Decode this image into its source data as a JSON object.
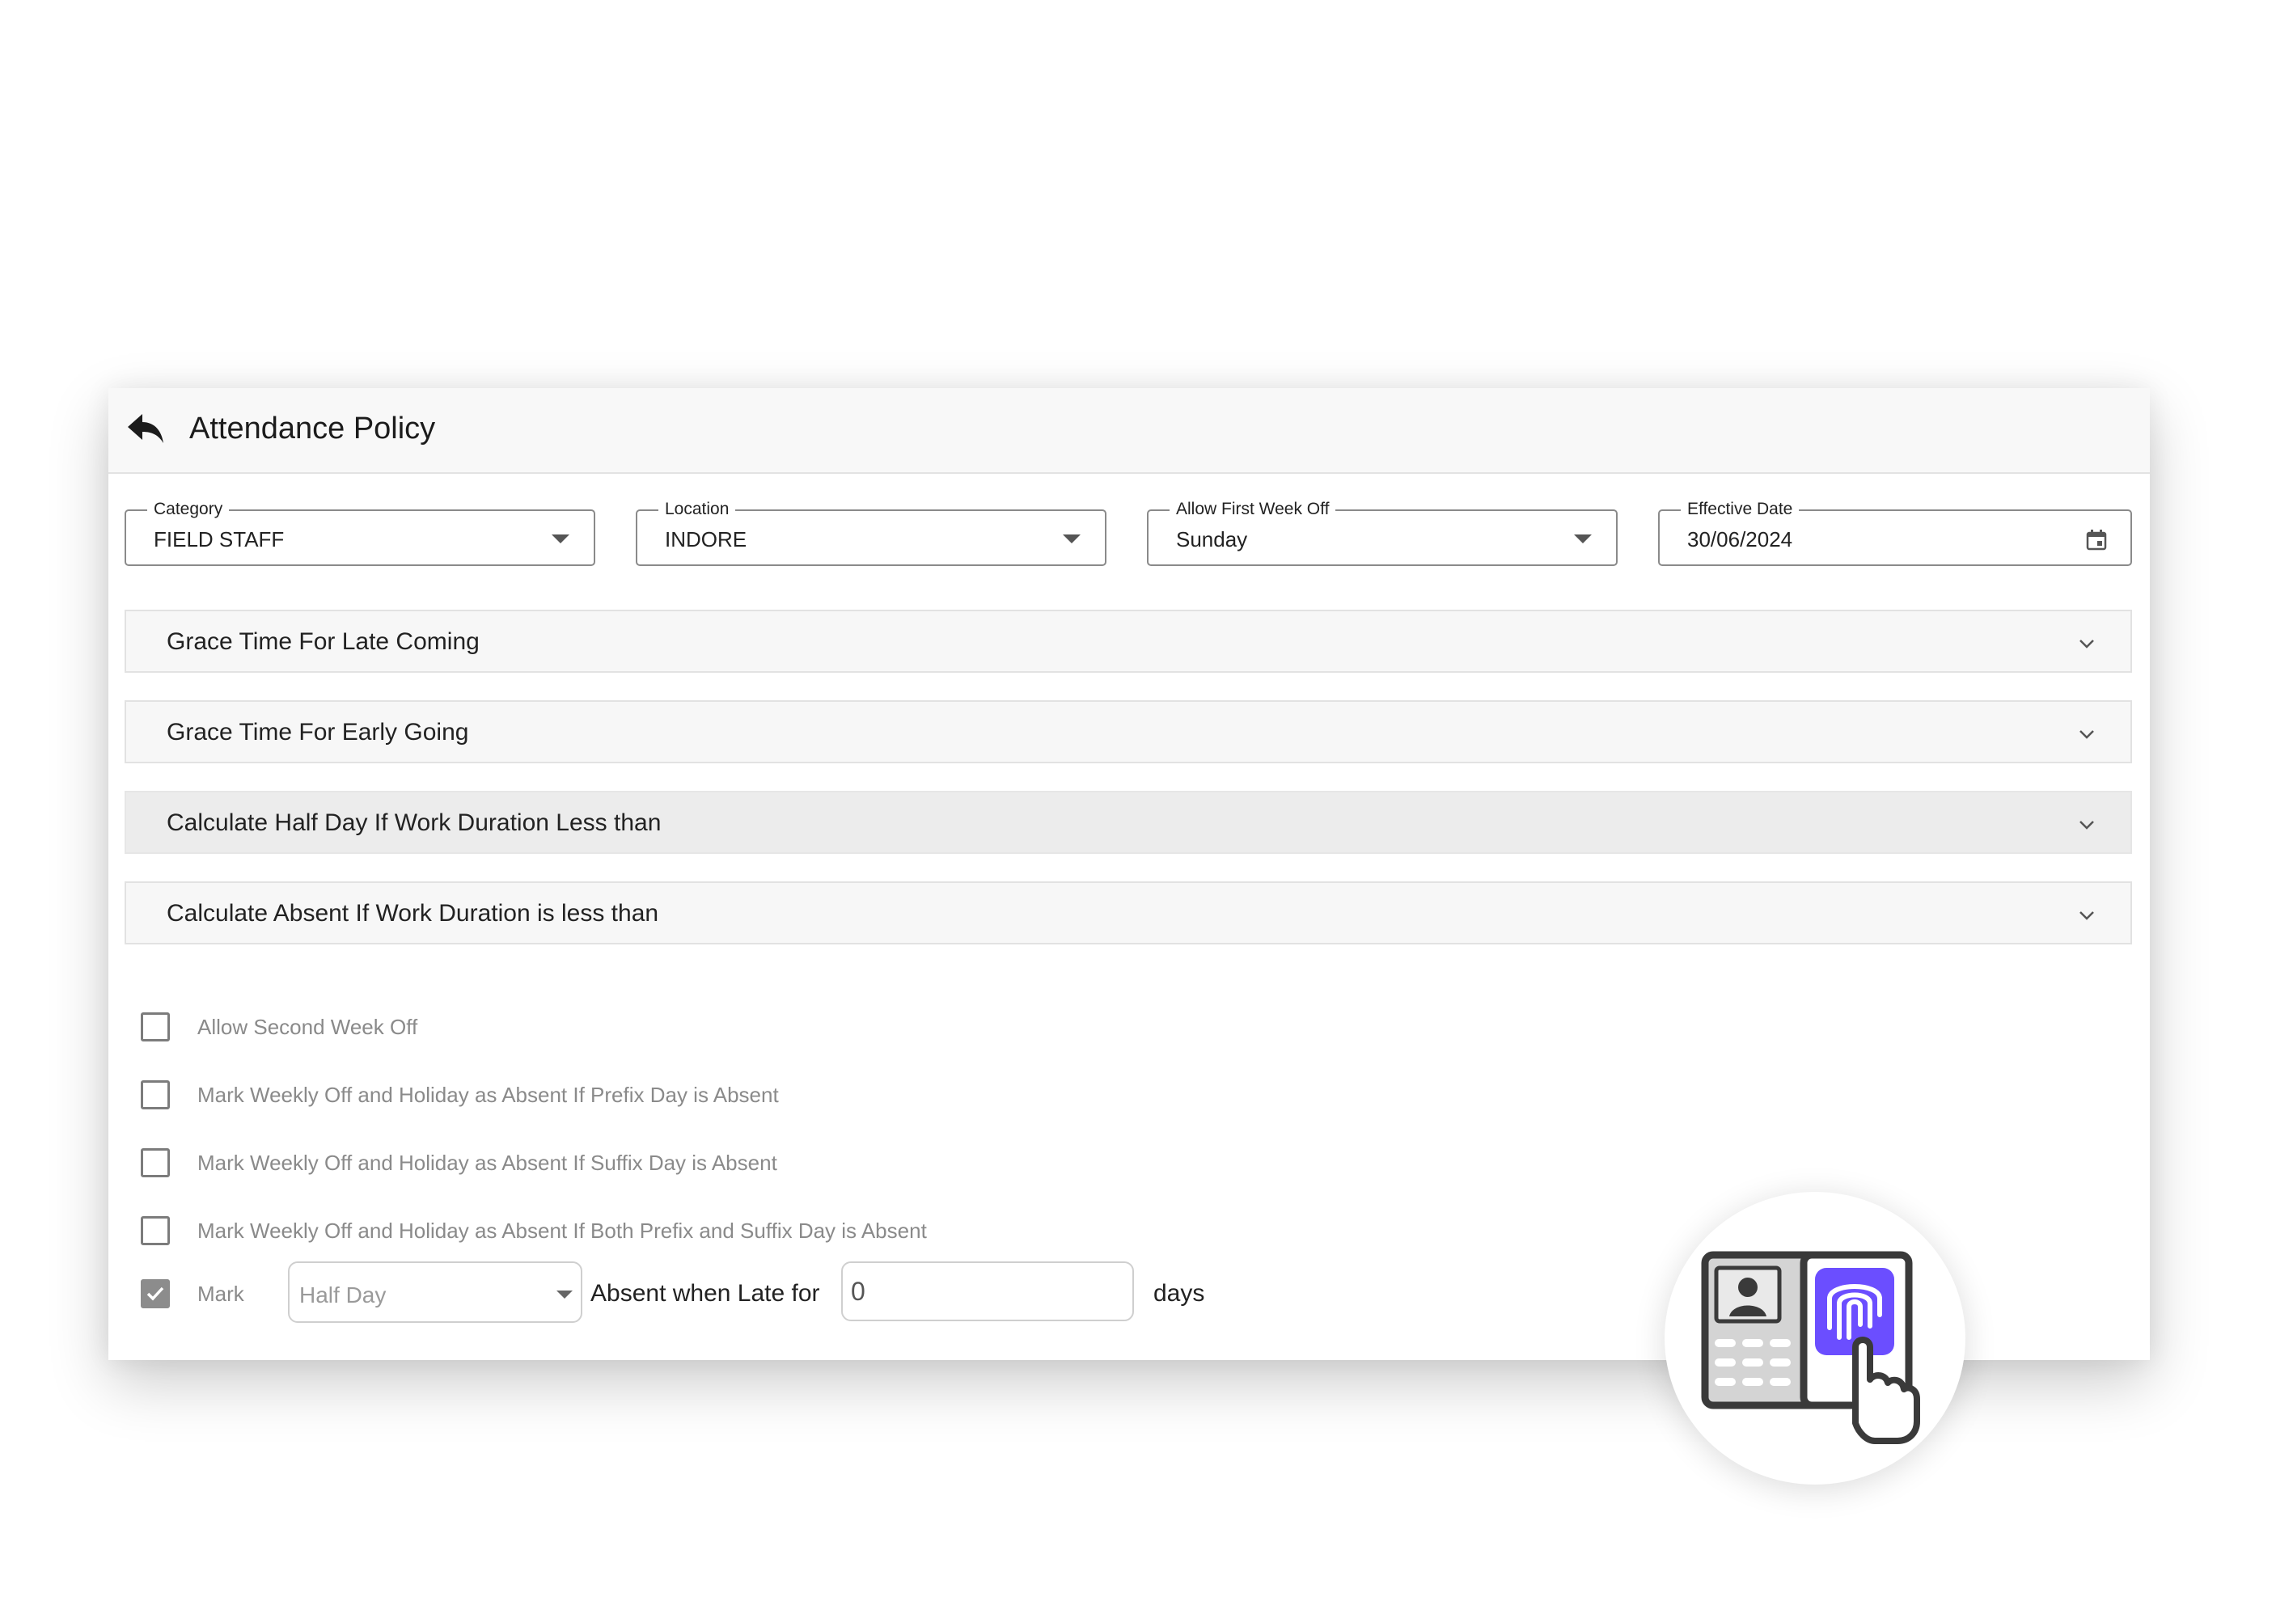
{
  "header": {
    "title": "Attendance Policy",
    "back_icon": "back-arrow-icon"
  },
  "filters": {
    "category": {
      "label": "Category",
      "value": "FIELD STAFF"
    },
    "location": {
      "label": "Location",
      "value": "INDORE"
    },
    "week_off": {
      "label": "Allow First Week Off",
      "value": "Sunday"
    },
    "effective_date": {
      "label": "Effective Date",
      "value": "30/06/2024"
    }
  },
  "sections": [
    {
      "title": "Grace Time For Late Coming"
    },
    {
      "title": "Grace Time For Early Going"
    },
    {
      "title": "Calculate Half Day If Work Duration Less than"
    },
    {
      "title": "Calculate Absent If Work Duration is less than"
    }
  ],
  "options": [
    {
      "label": "Allow Second Week Off",
      "checked": false
    },
    {
      "label": "Mark Weekly Off and Holiday as Absent If Prefix Day is Absent",
      "checked": false
    },
    {
      "label": "Mark Weekly Off and Holiday as Absent If Suffix Day is Absent",
      "checked": false
    },
    {
      "label": "Mark Weekly Off and Holiday as Absent If Both Prefix and Suffix Day is Absent",
      "checked": false
    }
  ],
  "late_rule": {
    "checked": true,
    "prefix": "Mark",
    "mark_type": "Half Day",
    "middle": "Absent when Late for",
    "days_value": "0",
    "suffix": "days"
  },
  "colors": {
    "accent_purple": "#6b4eff",
    "badge_frame": "#3a3a3a"
  },
  "icons": {
    "badge": "biometric-fingerprint-device-icon"
  }
}
